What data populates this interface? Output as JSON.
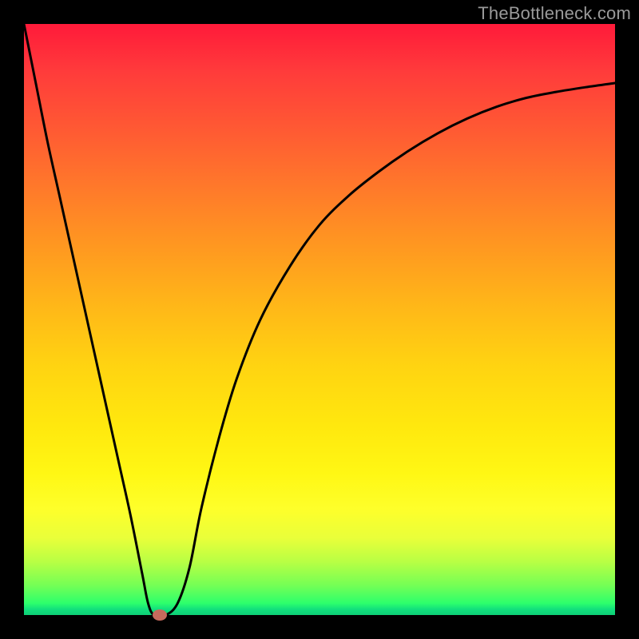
{
  "watermark": "TheBottleneck.com",
  "chart_data": {
    "type": "line",
    "title": "",
    "xlabel": "",
    "ylabel": "",
    "xlim": [
      0,
      100
    ],
    "ylim": [
      0,
      100
    ],
    "grid": false,
    "legend": false,
    "series": [
      {
        "name": "curve",
        "x": [
          0,
          2,
          4,
          6,
          8,
          10,
          12,
          14,
          16,
          18,
          20,
          21,
          22,
          24,
          26,
          28,
          30,
          33,
          36,
          40,
          45,
          50,
          55,
          60,
          65,
          70,
          75,
          80,
          85,
          90,
          95,
          100
        ],
        "y": [
          100,
          90,
          80,
          71,
          62,
          53,
          44,
          35,
          26,
          17,
          7,
          2,
          0,
          0,
          2,
          8,
          18,
          30,
          40,
          50,
          59,
          66,
          71,
          75,
          78.5,
          81.5,
          84,
          86,
          87.5,
          88.5,
          89.3,
          90
        ]
      }
    ],
    "marker": {
      "x": 23,
      "y": 0
    },
    "gradient_stops": [
      {
        "pos": 0,
        "color": "#ff1a3a"
      },
      {
        "pos": 50,
        "color": "#ffd411"
      },
      {
        "pos": 82,
        "color": "#feff2a"
      },
      {
        "pos": 100,
        "color": "#0ecf76"
      }
    ]
  }
}
